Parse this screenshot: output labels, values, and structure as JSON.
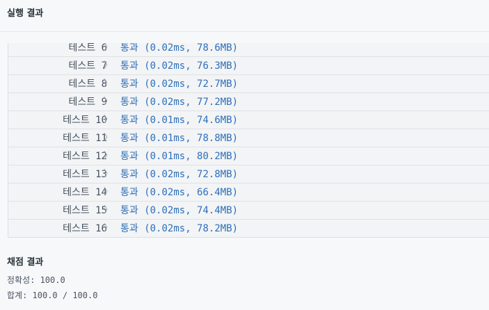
{
  "header": {
    "title": "실행 결과"
  },
  "tests": [
    {
      "label": "테스트 6",
      "result": "통과 (0.02ms, 78.6MB)"
    },
    {
      "label": "테스트 7",
      "result": "통과 (0.02ms, 76.3MB)"
    },
    {
      "label": "테스트 8",
      "result": "통과 (0.02ms, 72.7MB)"
    },
    {
      "label": "테스트 9",
      "result": "통과 (0.02ms, 77.2MB)"
    },
    {
      "label": "테스트 10",
      "result": "통과 (0.01ms, 74.6MB)"
    },
    {
      "label": "테스트 11",
      "result": "통과 (0.01ms, 78.8MB)"
    },
    {
      "label": "테스트 12",
      "result": "통과 (0.01ms, 80.2MB)"
    },
    {
      "label": "테스트 13",
      "result": "통과 (0.02ms, 72.8MB)"
    },
    {
      "label": "테스트 14",
      "result": "통과 (0.02ms, 66.4MB)"
    },
    {
      "label": "테스트 15",
      "result": "통과 (0.02ms, 74.4MB)"
    },
    {
      "label": "테스트 16",
      "result": "통과 (0.02ms, 78.2MB)"
    }
  ],
  "chevron": "〉",
  "scoring": {
    "title": "채점 결과",
    "accuracy": "정확성: 100.0",
    "total": "합계: 100.0 / 100.0"
  },
  "colors": {
    "pass": "#2d6fb8",
    "label": "#44505c",
    "background": "#f7f8fa"
  }
}
